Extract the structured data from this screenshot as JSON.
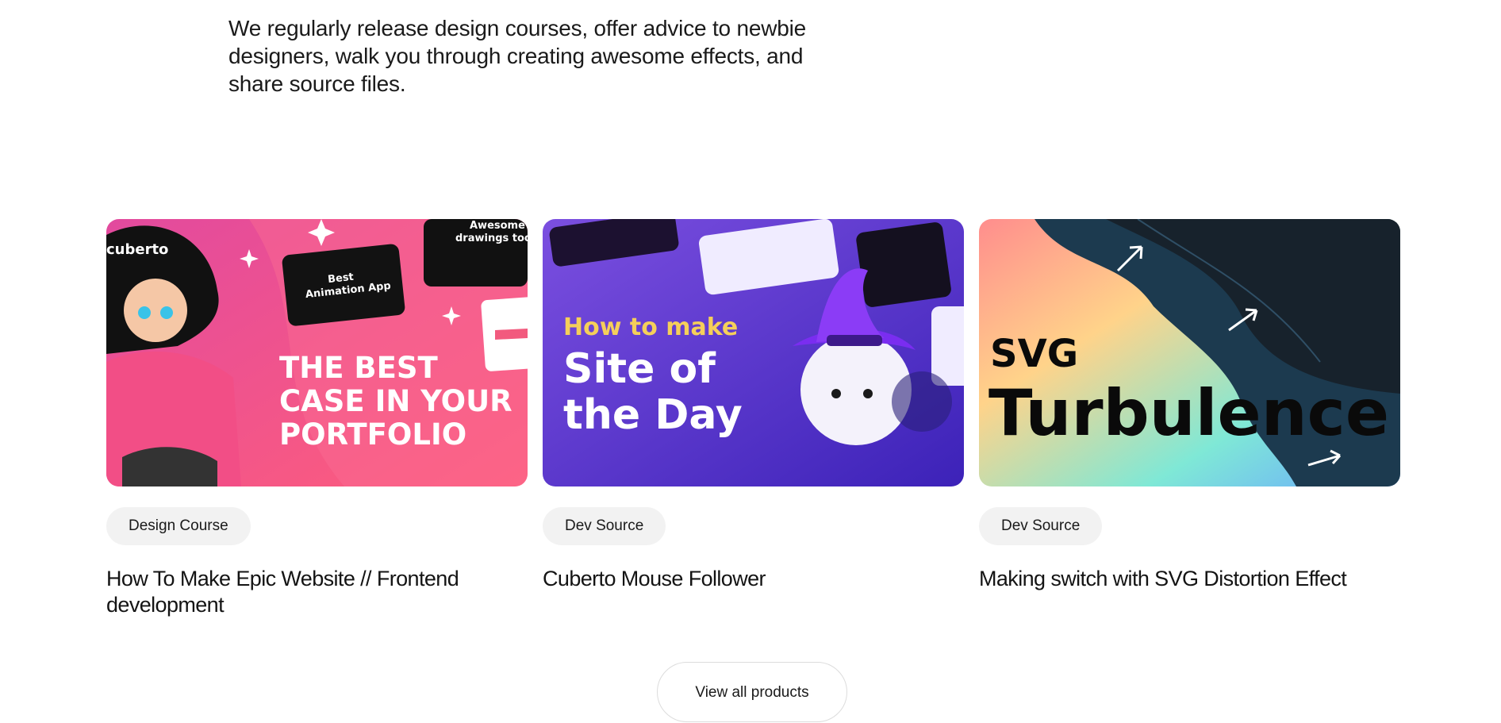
{
  "intro": {
    "text": "We regularly release design courses, offer advice to newbie designers, walk you through creating awesome effects, and share source files."
  },
  "cards": [
    {
      "tag": "Design Course",
      "title": "How To Make Epic Website // Frontend development",
      "thumb": {
        "brand": "cuberto",
        "headline": [
          "THE BEST",
          "CASE IN YOUR",
          "PORTFOLIO"
        ],
        "mock_app": [
          "Best",
          "Animation App"
        ],
        "mock_tools": [
          "Awesome",
          "drawings tools"
        ],
        "bg_color": "#f0558a"
      }
    },
    {
      "tag": "Dev Source",
      "title": "Cuberto Mouse Follower",
      "thumb": {
        "kicker": "How to make",
        "headline": [
          "Site of",
          "the Day"
        ],
        "bg_color": "#5b32c9",
        "accent_color": "#f5cf5a"
      }
    },
    {
      "tag": "Dev Source",
      "title": "Making switch with SVG Distortion Effect",
      "thumb": {
        "headline_small": "SVG",
        "headline_large": "Turbulence",
        "bg_color": "#1a2a38"
      }
    }
  ],
  "view_all_label": "View all products"
}
